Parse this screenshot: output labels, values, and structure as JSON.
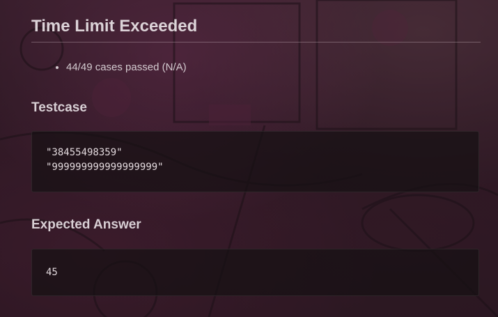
{
  "result": {
    "title": "Time Limit Exceeded",
    "summary": "44/49 cases passed (N/A)"
  },
  "testcase": {
    "heading": "Testcase",
    "lines": [
      "\"38455498359\"",
      "\"999999999999999999\""
    ]
  },
  "expected": {
    "heading": "Expected Answer",
    "value": "45"
  },
  "colors": {
    "text": "#d8cfd4",
    "background_tint": "#3a1f2e",
    "code_box": "#161014"
  }
}
